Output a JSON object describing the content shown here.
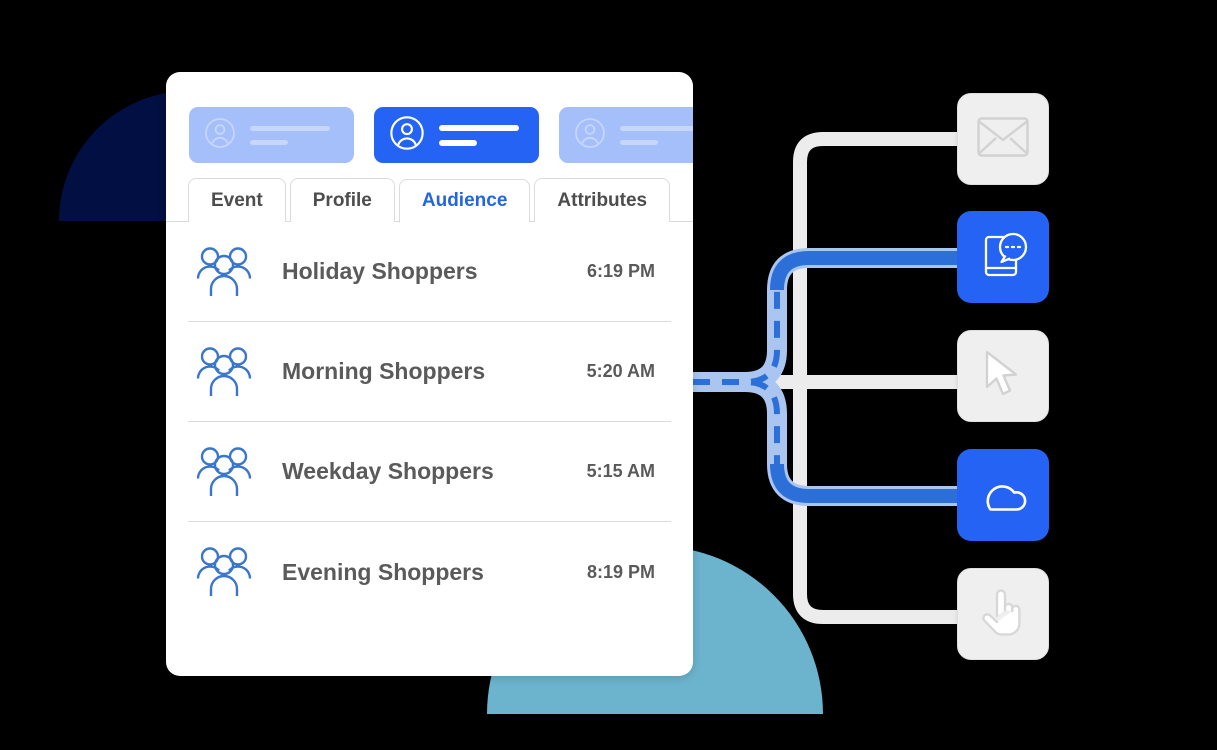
{
  "card": {
    "profile_pills": [
      {
        "id": "pill-1",
        "state": "inactive",
        "icon": "user-avatar-icon"
      },
      {
        "id": "pill-2",
        "state": "active",
        "icon": "user-avatar-icon"
      },
      {
        "id": "pill-3",
        "state": "inactive",
        "icon": "user-avatar-icon"
      }
    ],
    "tabs": [
      {
        "label": "Event",
        "active": false
      },
      {
        "label": "Profile",
        "active": false
      },
      {
        "label": "Audience",
        "active": true
      },
      {
        "label": "Attributes",
        "active": false
      }
    ],
    "audience_rows": [
      {
        "icon": "people-group-icon",
        "name": "Holiday Shoppers",
        "time": "6:19 PM"
      },
      {
        "icon": "people-group-icon",
        "name": "Morning Shoppers",
        "time": "5:20 AM"
      },
      {
        "icon": "people-group-icon",
        "name": "Weekday Shoppers",
        "time": "5:15 AM"
      },
      {
        "icon": "people-group-icon",
        "name": "Evening Shoppers",
        "time": "8:19 PM"
      }
    ]
  },
  "channels": [
    {
      "icon": "envelope-icon",
      "state": "inactive"
    },
    {
      "icon": "sms-chat-phone-icon",
      "state": "active"
    },
    {
      "icon": "cursor-arrow-icon",
      "state": "inactive"
    },
    {
      "icon": "cloud-icon",
      "state": "active"
    },
    {
      "icon": "pointing-hand-icon",
      "state": "inactive"
    }
  ],
  "colors": {
    "brand_blue": "#2563f5",
    "tab_active_text": "#2366e0",
    "pill_inactive": "#a5bffa",
    "connector_grey": "#ececec",
    "connector_blue": "#2d6fd8",
    "connector_blue_halo": "#aac6f0",
    "deco_navy": "#020f42",
    "deco_teal": "#6cb4ce",
    "text_grey": "#5a5a5a"
  }
}
